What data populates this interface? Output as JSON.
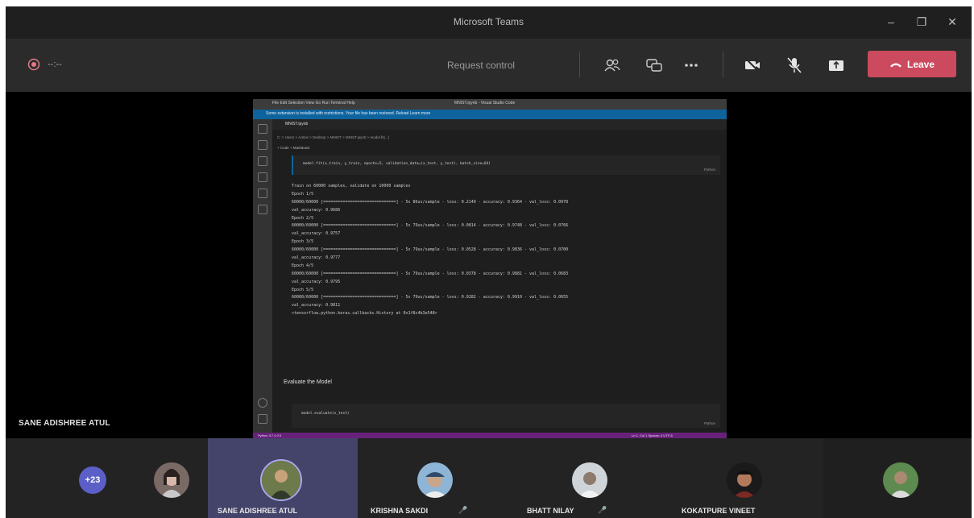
{
  "window": {
    "title": "Microsoft Teams",
    "controls": [
      "minimize-icon",
      "maximize-icon",
      "close-icon"
    ]
  },
  "toolbar": {
    "timer": "--:--",
    "request_control": "Request control",
    "leave_label": "Leave",
    "icons": [
      "people-icon",
      "chat-icon",
      "more-icon",
      "camera-off-icon",
      "mic-off-icon",
      "share-tray-icon",
      "phone-hangup-icon"
    ]
  },
  "stage": {
    "presenter_name": "SANE ADISHREE ATUL"
  },
  "shared_screen": {
    "menu": "File  Edit  Selection  View  Go  Run  Terminal  Help",
    "window_title": "MNIST.ipynb - Visual Studio Code",
    "banner": "Some extension is installed with restrictions. Your file has been restored. Reload   Learn more",
    "tab": "MNIST.ipynb",
    "breadcrumb": "C: > Users > Admin > Desktop > MNIST > MNIST.ipynb > model.fit(...)",
    "cell_toolbar": "+ Code  + Markdown",
    "cell1_code": "model.fit(x_train, y_train, epochs=5, validation_data=(x_test, y_test), batch_size=64)",
    "cell_lang": "Python",
    "output_lines": [
      "Train on 60000 samples, validate on 10000 samples",
      "Epoch 1/5",
      "60000/60000 [==============================] - 5s 86us/sample - loss: 0.2149 - accuracy: 0.9364 - val_loss: 0.0978",
      "val_accuracy: 0.9686",
      "Epoch 2/5",
      "60000/60000 [==============================] - 5s 79us/sample - loss: 0.0814 - accuracy: 0.9748 - val_loss: 0.0766",
      "val_accuracy: 0.9757",
      "Epoch 3/5",
      "60000/60000 [==============================] - 5s 79us/sample - loss: 0.0528 - accuracy: 0.9836 - val_loss: 0.0700",
      "val_accuracy: 0.9777",
      "Epoch 4/5",
      "60000/60000 [==============================] - 5s 79us/sample - loss: 0.0378 - accuracy: 0.9881 - val_loss: 0.0683",
      "val_accuracy: 0.9795",
      "Epoch 5/5",
      "60000/60000 [==============================] - 5s 79us/sample - loss: 0.0282 - accuracy: 0.9910 - val_loss: 0.0655",
      "val_accuracy: 0.9811",
      "<tensorflow.python.keras.callbacks.History at 0x1f8c4b3e548>"
    ],
    "markdown_heading": "Evaluate the Model",
    "cell2_code": "model.evaluate(x_test)",
    "status_left": "Python 3.7.4   0  0",
    "status_right": "Ln 1, Col 1   Spaces: 4   UTF-8"
  },
  "participants": {
    "overflow_count": "+23",
    "people": [
      {
        "name": "",
        "muted": false
      },
      {
        "name": "SANE ADISHREE ATUL",
        "muted": false,
        "active": true
      },
      {
        "name": "KRISHNA SAKDI",
        "muted": true
      },
      {
        "name": "BHATT NILAY",
        "muted": true
      },
      {
        "name": "KOKATPURE VINEET",
        "muted": false
      },
      {
        "name": "",
        "muted": false
      }
    ]
  },
  "colors": {
    "leave": "#cc4a5d",
    "overflow_badge": "#5b5fc7",
    "vscode_banner": "#0e639c",
    "vscode_status": "#68217a",
    "active_tile": "#44436a"
  }
}
